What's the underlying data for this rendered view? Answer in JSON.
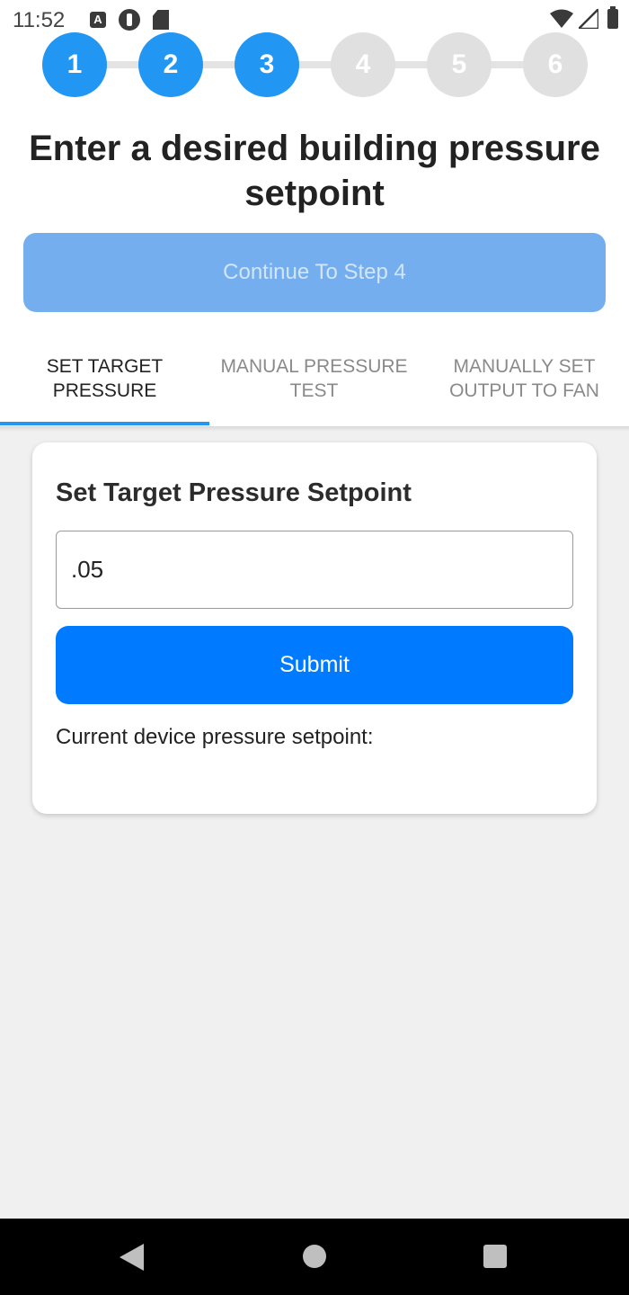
{
  "status_bar": {
    "time": "11:52",
    "left_icons": [
      "a-notification-icon",
      "app-notification-icon",
      "sd-card-icon"
    ],
    "right_icons": [
      "wifi-icon",
      "signal-icon",
      "battery-icon"
    ]
  },
  "stepper": {
    "steps": [
      {
        "label": "1",
        "state": "complete"
      },
      {
        "label": "2",
        "state": "complete"
      },
      {
        "label": "3",
        "state": "current"
      },
      {
        "label": "4",
        "state": "upcoming"
      },
      {
        "label": "5",
        "state": "upcoming"
      },
      {
        "label": "6",
        "state": "upcoming"
      }
    ],
    "active_color": "#2196f3",
    "inactive_color": "#e0e0e0"
  },
  "page": {
    "title": "Enter a desired building pressure setpoint",
    "continue_label": "Continue To Step 4"
  },
  "tabs": {
    "items": [
      {
        "label": "SET TARGET PRESSURE",
        "active": true
      },
      {
        "label": "MANUAL PRESSURE TEST",
        "active": false
      },
      {
        "label": "MANUALLY SET OUTPUT TO FAN",
        "active": false
      }
    ]
  },
  "card": {
    "title": "Set Target Pressure Setpoint",
    "input_value": ".05",
    "submit_label": "Submit",
    "current_label": "Current device pressure setpoint:"
  },
  "colors": {
    "primary": "#007bff",
    "accent": "#2196f3",
    "disabled_button": "#74aeee"
  },
  "nav_bar": {
    "icons": [
      "back-icon",
      "home-icon",
      "recents-icon"
    ]
  }
}
